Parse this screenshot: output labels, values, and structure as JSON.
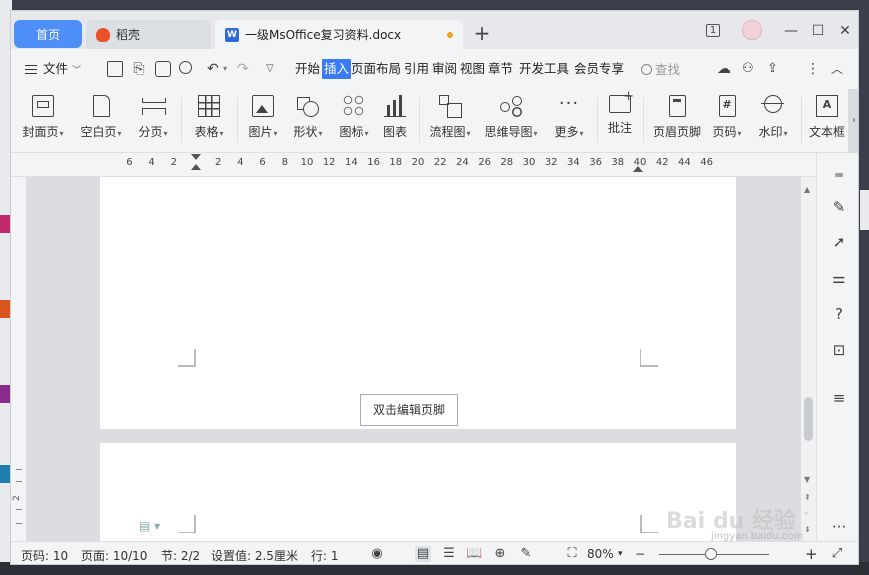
{
  "tabs": {
    "home": "首页",
    "daoke": "稻壳",
    "document": "一级MsOffice复习资料.docx",
    "new_tab": "+"
  },
  "window_controls": {
    "page_badge": "1",
    "minimize": "—",
    "maximize": "☐",
    "close": "✕"
  },
  "menu": {
    "file": "文件",
    "items": [
      "开始",
      "插入",
      "页面布局",
      "引用",
      "审阅",
      "视图",
      "章节",
      "开发工具",
      "会员专享"
    ],
    "active": "插入",
    "search": "查找"
  },
  "ribbon": {
    "items": [
      {
        "label": "封面页",
        "icon": "cover-page-icon",
        "dropdown": true
      },
      {
        "label": "空白页",
        "icon": "blank-page-icon",
        "dropdown": true
      },
      {
        "label": "分页",
        "icon": "page-break-icon",
        "dropdown": true
      },
      {
        "label": "表格",
        "icon": "table-icon",
        "dropdown": true
      },
      {
        "label": "图片",
        "icon": "picture-icon",
        "dropdown": true
      },
      {
        "label": "形状",
        "icon": "shape-icon",
        "dropdown": true
      },
      {
        "label": "图标",
        "icon": "icon-library-icon",
        "dropdown": true
      },
      {
        "label": "图表",
        "icon": "chart-icon",
        "dropdown": false
      },
      {
        "label": "流程图",
        "icon": "flowchart-icon",
        "dropdown": true
      },
      {
        "label": "思维导图",
        "icon": "mindmap-icon",
        "dropdown": true
      },
      {
        "label": "更多",
        "icon": "more-icon",
        "dropdown": true
      },
      {
        "label": "批注",
        "icon": "comment-icon",
        "dropdown": false
      },
      {
        "label": "页眉页脚",
        "icon": "header-footer-icon",
        "dropdown": false
      },
      {
        "label": "页码",
        "icon": "page-number-icon",
        "dropdown": true
      },
      {
        "label": "水印",
        "icon": "watermark-icon",
        "dropdown": true
      },
      {
        "label": "文本框",
        "icon": "textbox-icon",
        "dropdown": false
      }
    ]
  },
  "ruler": {
    "ticks": [
      "6",
      "4",
      "2",
      "2",
      "4",
      "6",
      "8",
      "10",
      "12",
      "14",
      "16",
      "18",
      "20",
      "22",
      "24",
      "26",
      "28",
      "30",
      "32",
      "34",
      "36",
      "38",
      "40",
      "42",
      "44",
      "46"
    ]
  },
  "document": {
    "footer_prompt": "双击编辑页脚"
  },
  "status": {
    "page": "页码: 10",
    "pages": "页面: 10/10",
    "section": "节: 2/2",
    "setting": "设置值: 2.5厘米",
    "line": "行: 1",
    "zoom": "80%"
  },
  "watermark": {
    "brand": "Bai du 经验",
    "url": "jingyan.baidu.com"
  }
}
